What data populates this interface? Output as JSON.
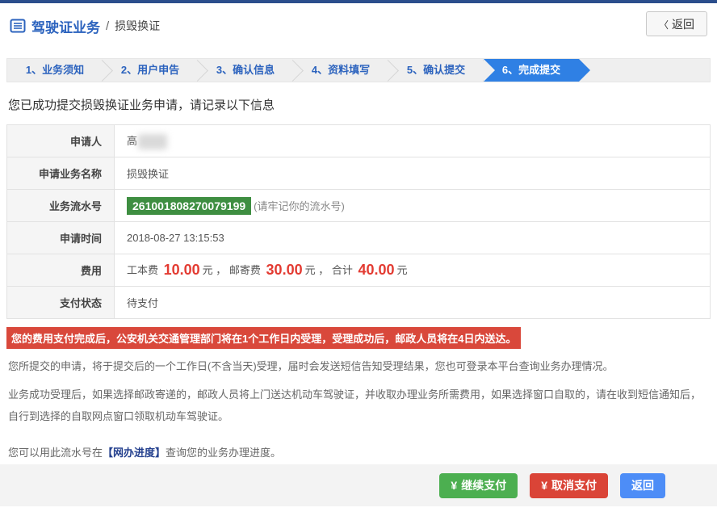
{
  "header": {
    "breadcrumb_primary": "驾驶证业务",
    "breadcrumb_separator": "/",
    "breadcrumb_secondary": "损毁换证",
    "back_button": {
      "icon": "〈",
      "label": "返回"
    }
  },
  "steps": {
    "items": [
      {
        "label": "1、业务须知",
        "active": false
      },
      {
        "label": "2、用户申告",
        "active": false
      },
      {
        "label": "3、确认信息",
        "active": false
      },
      {
        "label": "4、资料填写",
        "active": false
      },
      {
        "label": "5、确认提交",
        "active": false
      },
      {
        "label": "6、完成提交",
        "active": true
      }
    ]
  },
  "main": {
    "success_message": "您已成功提交损毁换证业务申请，请记录以下信息",
    "info_table": {
      "rows": [
        {
          "label": "申请人",
          "value": "高",
          "value_redacted": true
        },
        {
          "label": "申请业务名称",
          "value": "损毁换证"
        },
        {
          "label": "业务流水号",
          "serial": "261001808270079199",
          "note": "(请牢记你的流水号)"
        },
        {
          "label": "申请时间",
          "value": "2018-08-27 13:15:53"
        },
        {
          "label": "费用",
          "fee": [
            {
              "name": "工本费 ",
              "amount": "10.00",
              "suffix": "元 ，"
            },
            {
              "name": "邮寄费 ",
              "amount": "30.00",
              "suffix": "元 ，"
            },
            {
              "name": "合计 ",
              "amount": "40.00",
              "suffix": "元"
            }
          ]
        },
        {
          "label": "支付状态",
          "value": "待支付"
        }
      ]
    },
    "alert": "您的费用支付完成后，公安机关交通管理部门将在1个工作日内受理，受理成功后，邮政人员将在4日内送达。",
    "paragraph1": "您所提交的申请，将于提交后的一个工作日(不含当天)受理，届时会发送短信告知受理结果，您也可登录本平台查询业务办理情况。",
    "paragraph2": "业务成功受理后，如果选择邮政寄递的，邮政人员将上门送达机动车驾驶证，并收取办理业务所需费用，如果选择窗口自取的，请在收到短信通知后，自行到选择的自取网点窗口领取机动车驾驶证。",
    "progress_note": {
      "prefix": "您可以用此流水号在",
      "link": "【网办进度】",
      "suffix": "查询您的业务办理进度。"
    }
  },
  "footer": {
    "buttons": [
      {
        "icon": "¥",
        "label": "继续支付",
        "color": "#4CAF50"
      },
      {
        "icon": "¥",
        "label": "取消支付",
        "color": "#DA4437"
      },
      {
        "icon": "",
        "label": "返回",
        "color": "#4D8DF7"
      }
    ]
  },
  "colors": {
    "topbar_navy": "#2B4E8C",
    "breadcrumb_blue": "#2C63BE",
    "step_active_blue": "#2F80E4",
    "serial_green": "#3E8E41",
    "fee_red": "#E33B32",
    "alert_red": "#D9483B",
    "button_green": "#4CAF50",
    "button_red": "#DA4437",
    "button_blue": "#4D8DF7"
  }
}
